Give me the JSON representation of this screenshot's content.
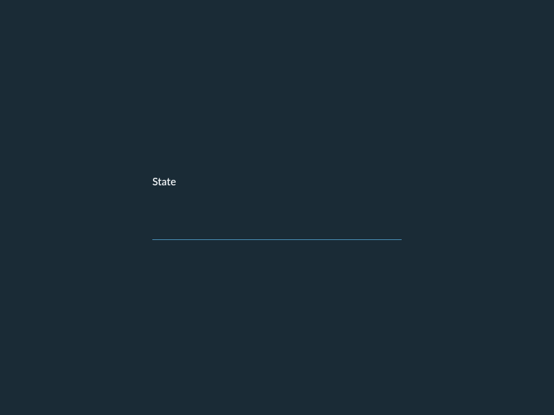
{
  "form": {
    "state": {
      "label": "State",
      "value": "",
      "placeholder": ""
    }
  },
  "colors": {
    "background": "#1a2b36",
    "label": "#eef2f5",
    "underline": "#4a90b8"
  }
}
